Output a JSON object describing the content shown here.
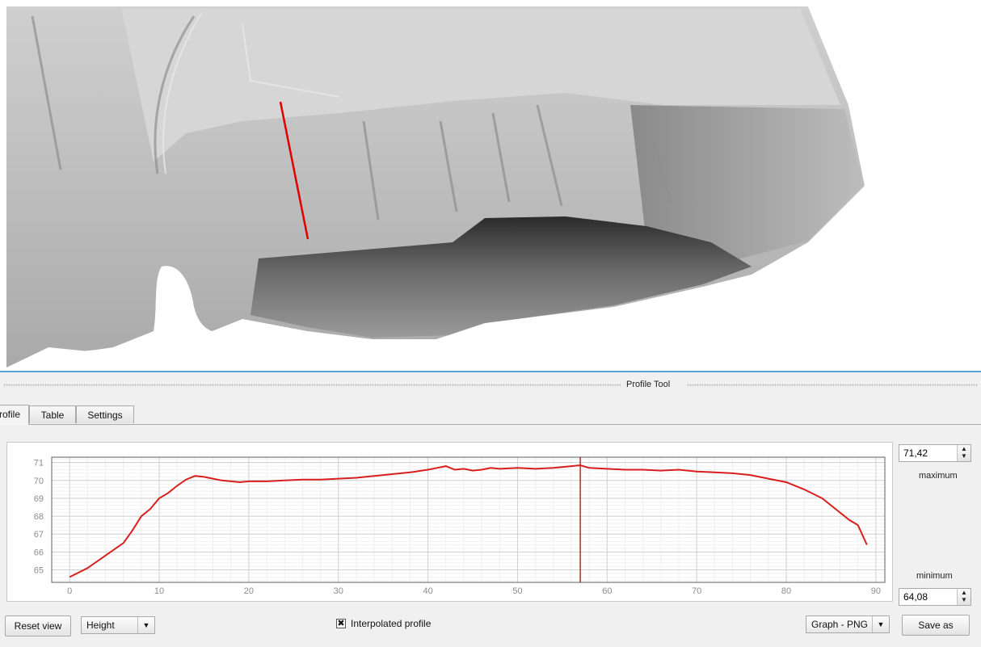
{
  "dock": {
    "title": "Profile Tool"
  },
  "tabs": [
    {
      "label": "Profile",
      "active": true
    },
    {
      "label": "Table",
      "active": false
    },
    {
      "label": "Settings",
      "active": false
    }
  ],
  "scale": {
    "maximum_value": "71,42",
    "maximum_label": "maximum",
    "minimum_label": "minimum",
    "minimum_value": "64,08"
  },
  "controls": {
    "reset_view": "Reset view",
    "plot_mode": "Height",
    "interpolated_checked": true,
    "interpolated_label": "Interpolated profile",
    "export_format": "Graph - PNG",
    "save_as": "Save as"
  },
  "colors": {
    "profile_line": "#d81e1e",
    "selection_line": "#e00000",
    "accent": "#4fa3d9"
  },
  "chart_data": {
    "type": "line",
    "title": "",
    "xlabel": "",
    "ylabel": "",
    "xlim": [
      -2,
      91
    ],
    "ylim": [
      64.3,
      71.3
    ],
    "x_ticks": [
      "0",
      "10",
      "20",
      "30",
      "40",
      "50",
      "60",
      "70",
      "80",
      "90"
    ],
    "y_ticks": [
      "65",
      "66",
      "67",
      "68",
      "69",
      "70",
      "71"
    ],
    "grid": true,
    "cursor_x": 57,
    "series": [
      {
        "name": "",
        "x": [
          0,
          2,
          4,
          6,
          7,
          8,
          9,
          10,
          11,
          12,
          13,
          14,
          15,
          16,
          17,
          18,
          19,
          20,
          22,
          24,
          26,
          28,
          30,
          32,
          34,
          36,
          38,
          40,
          41,
          42,
          43,
          44,
          45,
          46,
          47,
          48,
          50,
          52,
          54,
          56,
          57,
          58,
          60,
          62,
          64,
          66,
          68,
          70,
          72,
          74,
          76,
          78,
          80,
          81,
          82,
          84,
          86,
          87,
          88,
          89
        ],
        "y": [
          64.6,
          65.1,
          65.8,
          66.5,
          67.2,
          68.0,
          68.4,
          69.0,
          69.3,
          69.7,
          70.05,
          70.25,
          70.2,
          70.1,
          70.0,
          69.95,
          69.9,
          69.95,
          69.95,
          70.0,
          70.05,
          70.05,
          70.1,
          70.15,
          70.25,
          70.35,
          70.45,
          70.6,
          70.7,
          70.8,
          70.6,
          70.65,
          70.55,
          70.6,
          70.7,
          70.65,
          70.7,
          70.65,
          70.7,
          70.8,
          70.85,
          70.7,
          70.65,
          70.6,
          70.6,
          70.55,
          70.6,
          70.5,
          70.45,
          70.4,
          70.3,
          70.1,
          69.9,
          69.7,
          69.5,
          69.0,
          68.2,
          67.8,
          67.5,
          66.4
        ]
      }
    ]
  }
}
